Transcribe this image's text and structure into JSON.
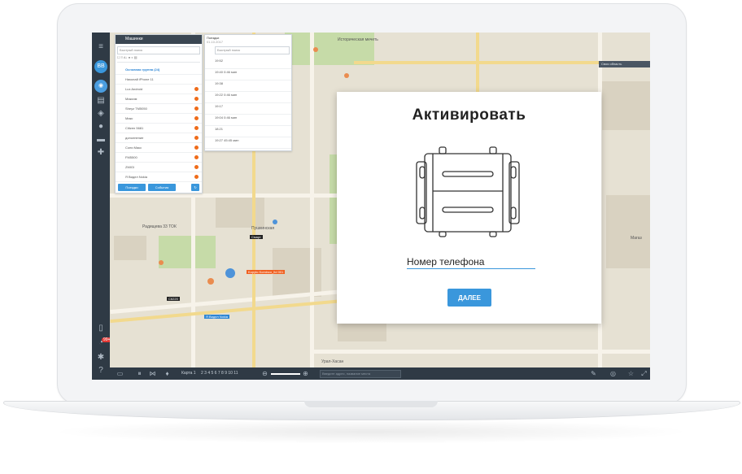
{
  "dialog": {
    "title": "Активировать",
    "phone_placeholder": "Номер телефона",
    "next_button": "ДАЛЕЕ"
  },
  "objects_panel": {
    "title": "Машинки",
    "search_placeholder": "Быстрый поиск",
    "items": [
      "Основная группа (24)",
      "Николай iPhone 11",
      "Lux Android",
      "Максим",
      "Sheyz TM5050",
      "Макс",
      "Citizen 5681",
      "дополнение",
      "Сони Макс",
      "FM5500",
      "ZMIGI",
      "Я Видел Nokia"
    ],
    "btn_trips": "Поездки",
    "btn_events": "События"
  },
  "trips_panel": {
    "title": "Поездки",
    "date": "01.10.2017",
    "search_placeholder": "Быстрый поиск",
    "rows": [
      "19:52",
      "19:40   0:46 мин",
      "19:38",
      "19:22   0:46 мин",
      "19:17",
      "19:04   0:46 мин",
      "18:21",
      "19:27 45:45 мин"
    ]
  },
  "map": {
    "search_hint": "Своя область",
    "labels": [
      "Историческая мечеть",
      "Радищева 33 ТОК",
      "Пушкинская",
      "Урал-Хасан",
      "Магаз"
    ],
    "poi_orange": "Kopyto Kominco_ltd 001",
    "poi_blue": "Я Видел Nokia",
    "poi_dark1": "Смарт",
    "poi_dark2": "С6220"
  },
  "bottombar": {
    "page_label": "Карта 1",
    "pages": "2  3  4  5  6  7  8  9  10  11",
    "search_placeholder": "Введите адрес, название места"
  },
  "sidebar": {
    "badge": "99+",
    "avatar_text": "ВВ"
  }
}
